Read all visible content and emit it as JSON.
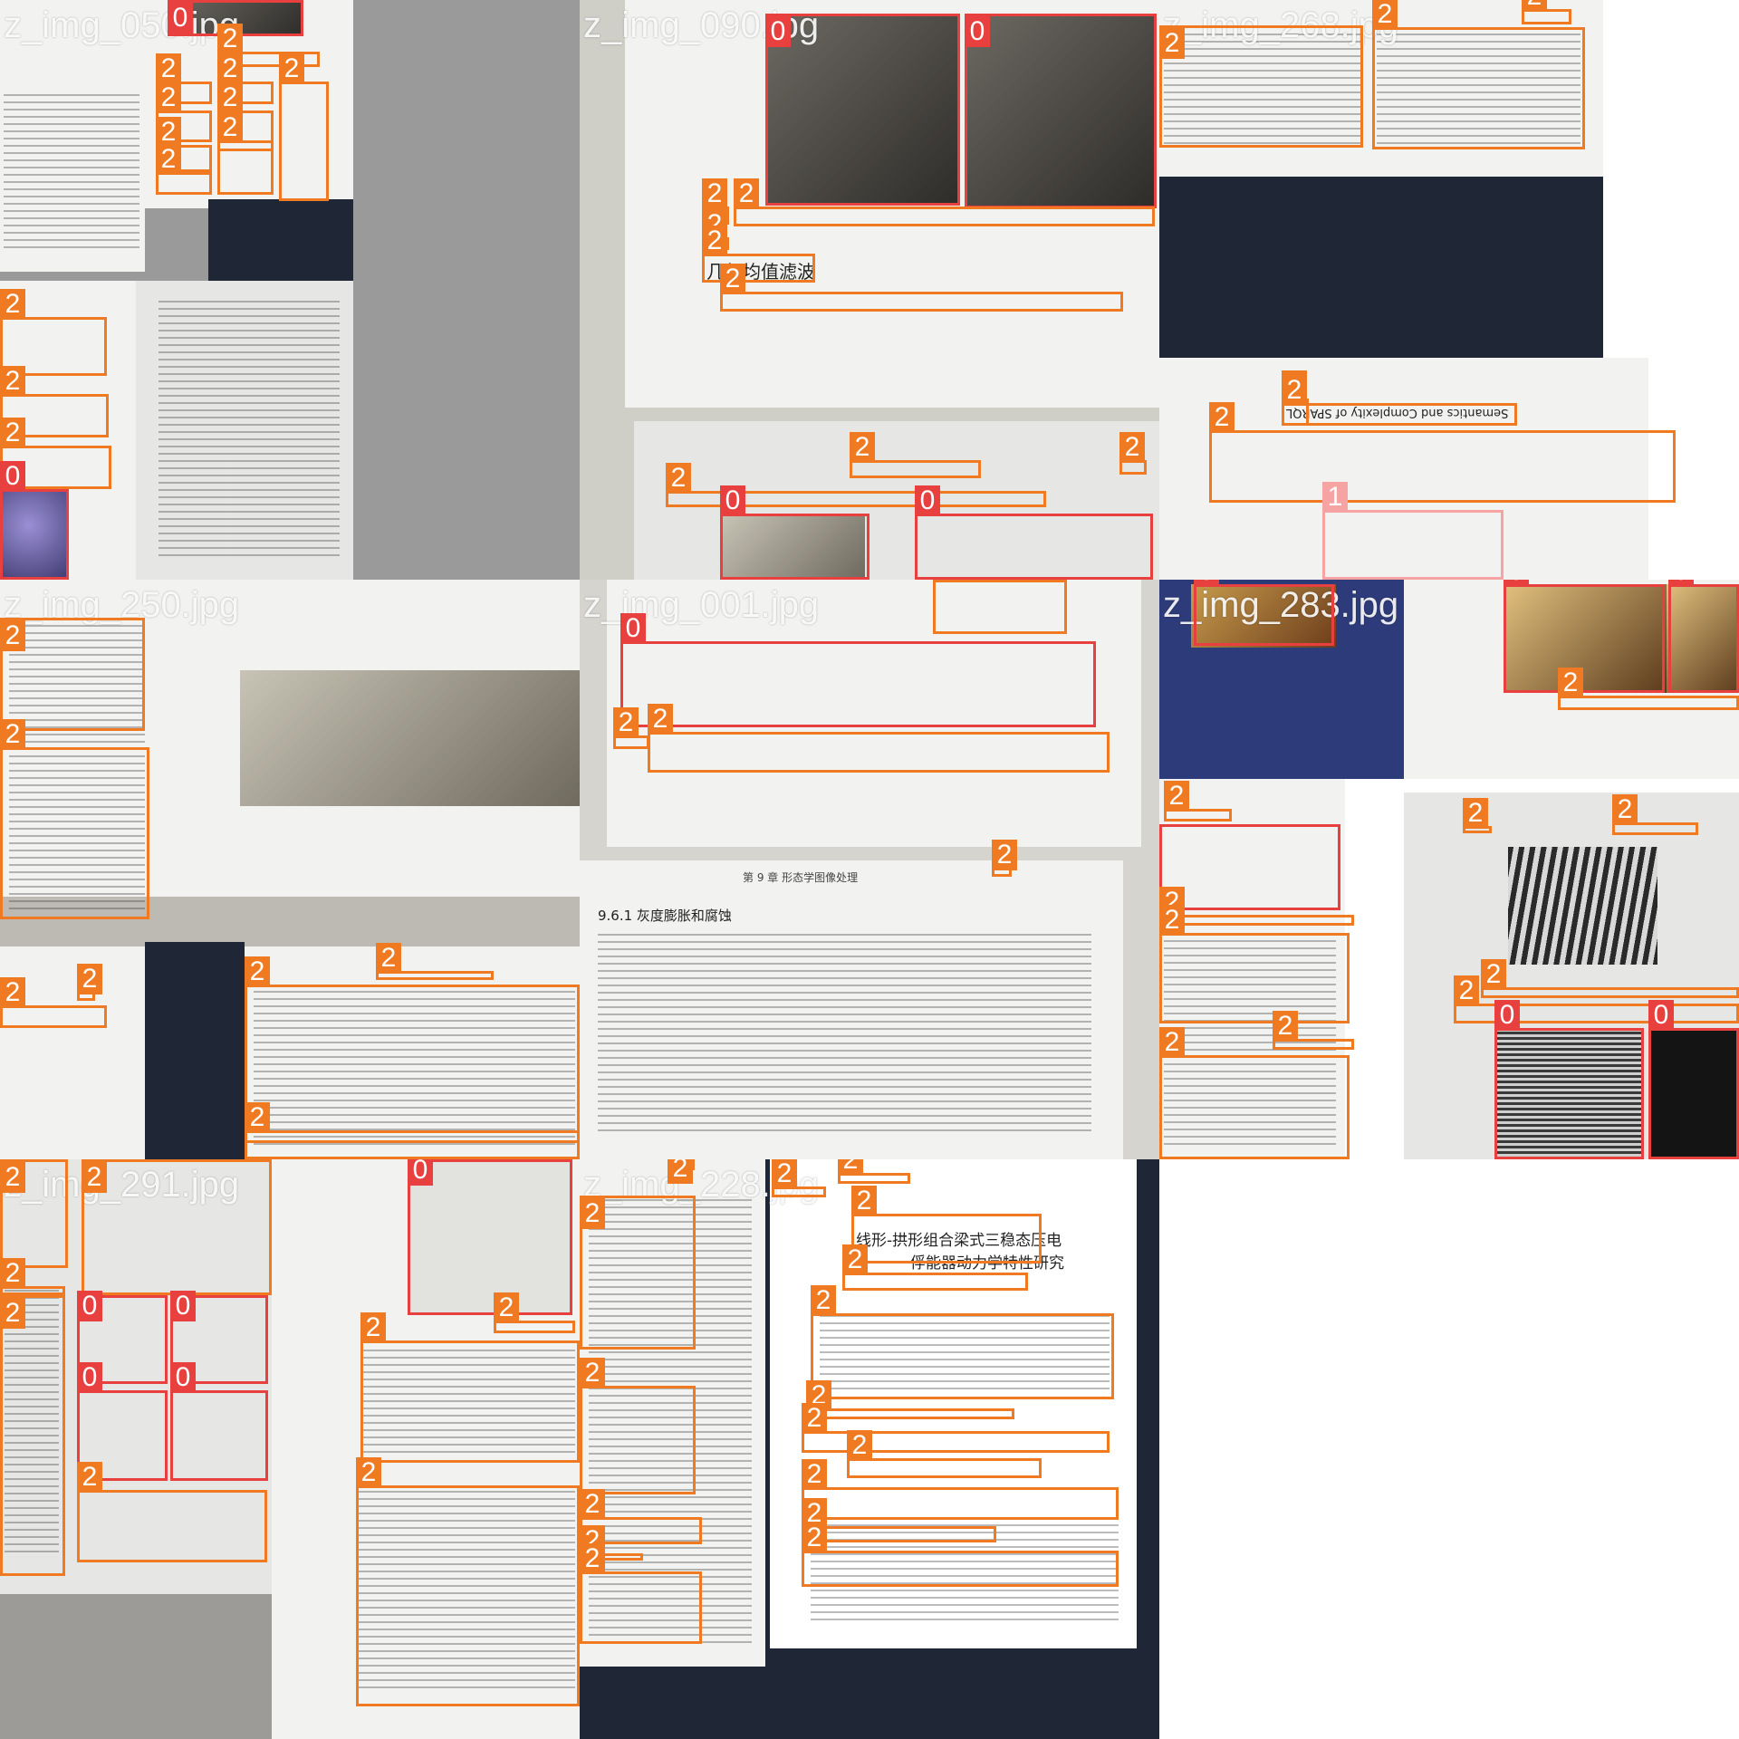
{
  "tiles": [
    {
      "filename": "z_img_050.jpg"
    },
    {
      "filename": "z_img_090.jpg"
    },
    {
      "filename": "z_img_268.jpg"
    },
    {
      "filename": "z_img_250.jpg"
    },
    {
      "filename": "z_img_001.jpg"
    },
    {
      "filename": "z_img_283.jpg"
    },
    {
      "filename": "z_img_291.jpg"
    },
    {
      "filename": "z_img_228.jpg"
    }
  ],
  "visible_text": {
    "geo_mean_filter": "几何均值滤波",
    "sparql_heading": "Semantics and Complexity of SPARQL",
    "dilation_section": "9.6.1   灰度膨胀和腐蚀",
    "paper_title_line1": "线形-拱形组合梁式三稳态压电",
    "paper_title_line2": "俘能器动力学特性研究",
    "chapter_header": "第 9 章   形态学图像处理"
  },
  "class_labels": {
    "figure": "0",
    "table": "1",
    "text": "2"
  },
  "colors": {
    "figure": "#e8403f",
    "table": "#f5a3a3",
    "text": "#f07a22"
  }
}
